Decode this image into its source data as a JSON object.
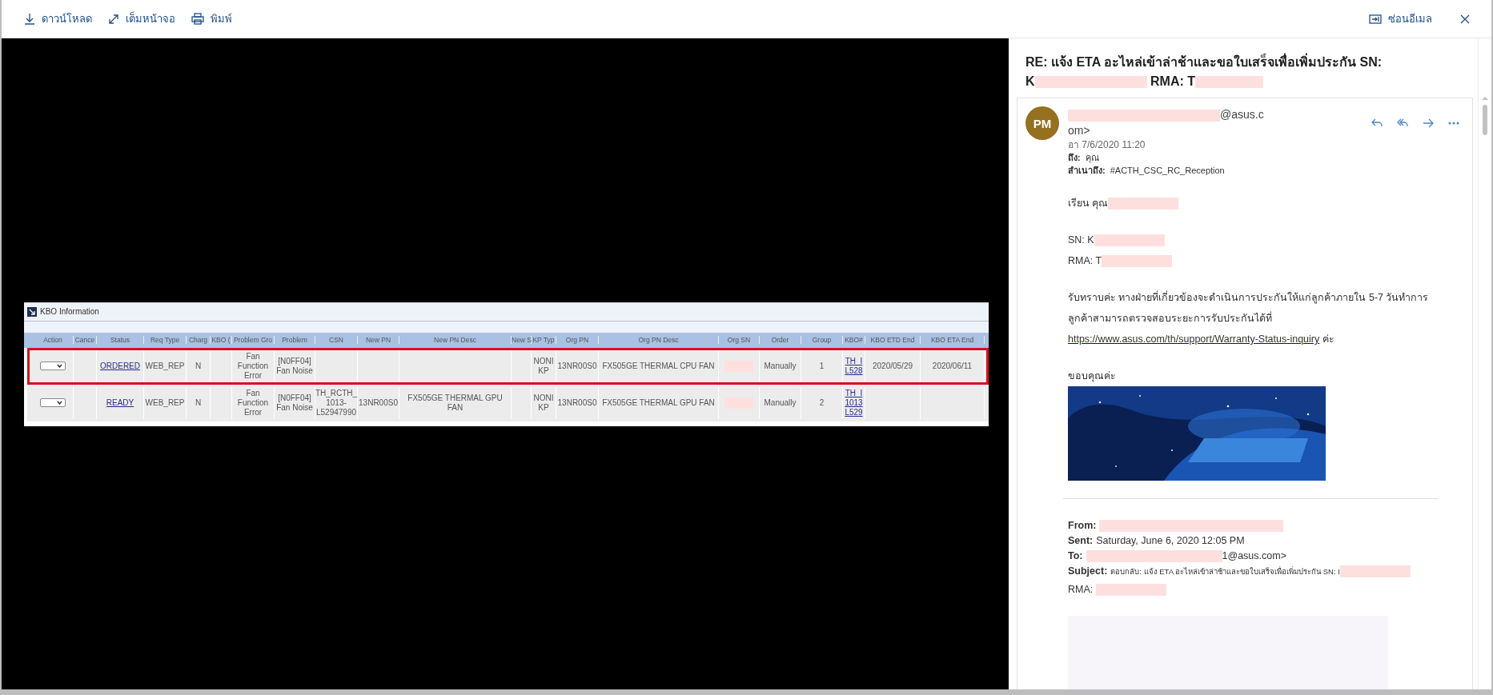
{
  "toolbar": {
    "actions": [
      {
        "label": "ดาวน์โหลด"
      },
      {
        "label": "เต็มหน้าจอ"
      },
      {
        "label": "พิมพ์"
      }
    ],
    "hide_mail": {
      "label": "ซ่อนอีเมล"
    }
  },
  "attachment": {
    "title": "KBO Information",
    "columns": [
      {
        "label": "Action",
        "kind": "select"
      },
      {
        "label": "Cance",
        "kind": "text"
      },
      {
        "label": "Status",
        "kind": "link"
      },
      {
        "label": "Req Type",
        "kind": "text"
      },
      {
        "label": "Charg",
        "kind": "text"
      },
      {
        "label": "KBO (",
        "kind": "text"
      },
      {
        "label": "Problem Gro",
        "kind": "text"
      },
      {
        "label": "Problem",
        "kind": "text"
      },
      {
        "label": "CSN",
        "kind": "text"
      },
      {
        "label": "New PN",
        "kind": "text"
      },
      {
        "label": "New PN Desc",
        "kind": "text"
      },
      {
        "label": "New S",
        "kind": "text"
      },
      {
        "label": "KP Typ",
        "kind": "text"
      },
      {
        "label": "Org PN",
        "kind": "text"
      },
      {
        "label": "Org PN Desc",
        "kind": "text"
      },
      {
        "label": "Org SN",
        "kind": "redacted"
      },
      {
        "label": "Order",
        "kind": "text"
      },
      {
        "label": "Group",
        "kind": "text"
      },
      {
        "label": "KBO#",
        "kind": "link"
      },
      {
        "label": "KBO ETD End",
        "kind": "text"
      },
      {
        "label": "KBO ETA End",
        "kind": "text"
      }
    ],
    "rows": [
      {
        "outlined": true,
        "cells": [
          null,
          null,
          "ORDERED",
          "WEB_REP",
          "N",
          null,
          "Fan\nFunction\nError",
          "[N0FF04]\nFan Noise",
          null,
          null,
          null,
          null,
          "NONI\nKP",
          "13NR00S0",
          "FX505GE THERMAL CPU FAN",
          null,
          "Manually",
          "1",
          "TH_I\nL528",
          "2020/05/29",
          "2020/06/11"
        ]
      },
      {
        "outlined": false,
        "cells": [
          null,
          null,
          "READY",
          "WEB_REP",
          "N",
          null,
          "Fan\nFunction\nError",
          "[N0FF04]\nFan Noise",
          "TH_RCTH_\n1013-\nL52947990",
          "13NR00S0",
          "FX505GE THERMAL GPU FAN",
          null,
          "NONI\nKP",
          "13NR00S0",
          "FX505GE THERMAL GPU FAN",
          null,
          "Manually",
          "2",
          "TH_I\n1013\nL529",
          null,
          null
        ]
      }
    ]
  },
  "mail": {
    "subject": [
      {
        "text": "RE: แจ้ง ETA อะไหล่เข้าล่าช้าและขอใบเสร็จเพื่อเพิ่มประกัน SN: K",
        "redacted_after": true
      },
      {
        "text": "RMA: T",
        "redacted_after": true
      }
    ],
    "message": {
      "avatar": "PM",
      "sender": {
        "text": "@asus.c\nom>",
        "redacted_before": true
      },
      "date": "อา 7/6/2020 11:20",
      "recipients": [
        {
          "label": "ถึง:",
          "value": "คุณ"
        },
        {
          "label": "สำเนาถึง:",
          "value": "#ACTH_CSC_RC_Reception"
        }
      ],
      "blocks": [
        [
          {
            "kind": "text",
            "text": "เรียน คุณ",
            "redacted_after": true
          }
        ],
        [
          {
            "kind": "text",
            "text": "SN: K",
            "redacted_after": true
          },
          {
            "kind": "text",
            "text": "RMA: T",
            "redacted_after": true
          }
        ],
        [
          {
            "kind": "text",
            "text": "รับทราบค่ะ ทางฝ่ายที่เกี่ยวข้องจะดำเนินการประกันให้แก่ลูกค้าภายใน 5-7 วันทำการ"
          },
          {
            "kind": "text",
            "text": "ลูกค้าสามารถตรวจสอบระยะการรับประกันได้ที่"
          },
          {
            "kind": "link",
            "text": "https://www.asus.com/th/support/Warranty-Status-inquiry",
            "suffix": " ค่ะ"
          }
        ],
        [
          {
            "kind": "text",
            "text": "ขอบคุณค่ะ"
          },
          {
            "kind": "picture"
          }
        ],
        [
          {
            "kind": "divider"
          }
        ],
        [
          {
            "kind": "field",
            "label": "From:",
            "redacted_before": true
          },
          {
            "kind": "field",
            "label": "Sent:",
            "text": "Saturday, June 6, 2020 12:05 PM"
          },
          {
            "kind": "field",
            "label": "To:",
            "text": "1@asus.com>",
            "redacted_before": true
          },
          {
            "kind": "field_small",
            "label": "Subject:",
            "text": "ตอบกลับ: แจ้ง ETA อะไหล่เข้าล่าช้าและขอใบเสร็จเพื่อเพิ่มประกัน SN: I",
            "redacted_after": true
          },
          {
            "kind": "text",
            "text": "RMA: ",
            "redacted_after": true
          }
        ],
        [
          {
            "kind": "placeholder"
          }
        ]
      ]
    }
  }
}
